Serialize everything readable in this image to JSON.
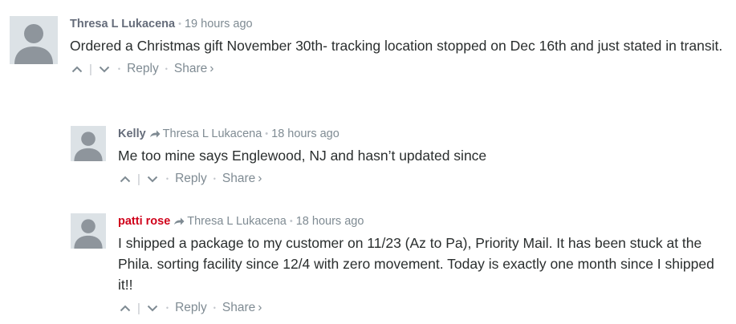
{
  "comments": [
    {
      "author": "Thresa L Lukacena",
      "author_color": "#656c7a",
      "reply_to": "",
      "time": "19 hours ago",
      "text": "Ordered a Christmas gift November 30th- tracking location stopped on Dec 16th and just stated in transit."
    },
    {
      "author": "Kelly",
      "author_color": "#656c7a",
      "reply_to": "Thresa L Lukacena",
      "time": "18 hours ago",
      "text": "Me too mine says Englewood, NJ and hasn’t updated since"
    },
    {
      "author": "patti rose",
      "author_color": "#d0021b",
      "reply_to": "Thresa L Lukacena",
      "time": "18 hours ago",
      "text": "I shipped a package to my customer on 11/23 (Az to Pa), Priority Mail. It has been stuck at the Phila. sorting facility since 12/4 with zero movement. Today is exactly one month since I shipped it!!"
    }
  ],
  "actions": {
    "reply_label": "Reply",
    "share_label": "Share",
    "share_chevron": "›",
    "meta_separator": "•"
  },
  "icons": {
    "upvote": "chevron-up-icon",
    "downvote": "chevron-down-icon",
    "reply_to": "reply-arrow-icon",
    "avatar": "default-avatar-icon"
  }
}
